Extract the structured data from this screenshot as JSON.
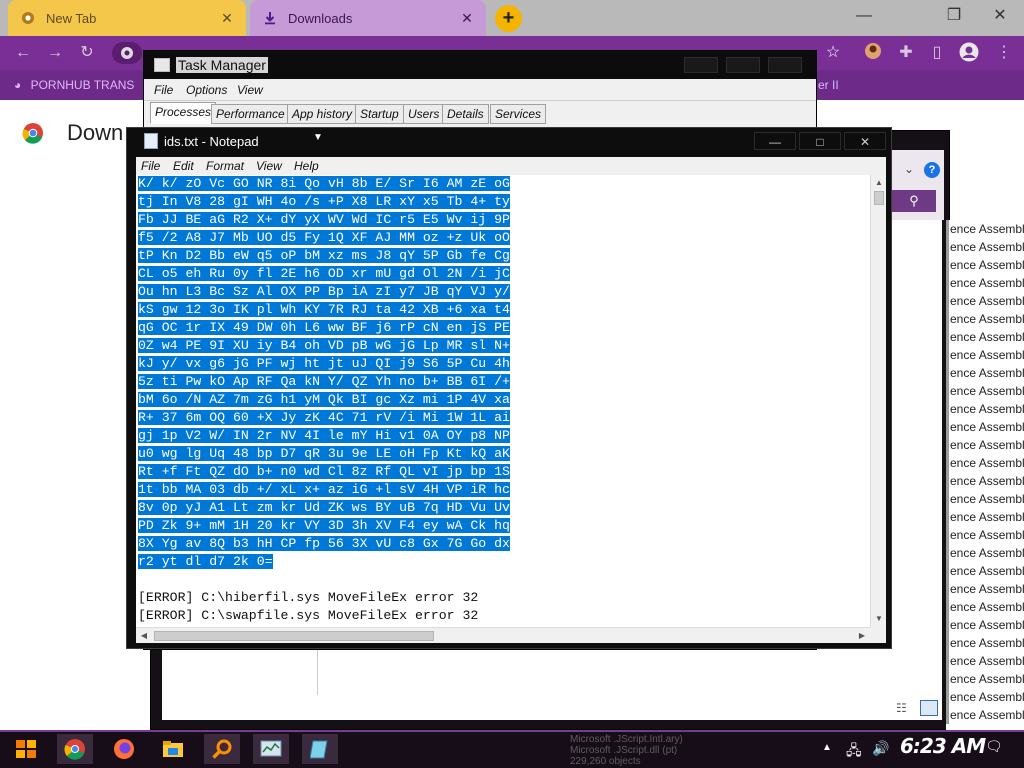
{
  "browser": {
    "tabs": [
      {
        "label": "New Tab",
        "close": "✕"
      },
      {
        "label": "Downloads",
        "close": "✕"
      }
    ],
    "new_tab": "+",
    "window_controls": [
      "—",
      "❐",
      "✕"
    ],
    "bookmark": "PORNHUB TRANS",
    "bookmark_tail": "er II",
    "page_title": "Down",
    "icons": {
      "back": "arrow-left-icon",
      "forward": "arrow-right-icon",
      "reload": "reload-icon",
      "star": "star-icon",
      "extensions": "puzzle-icon",
      "sidepanel": "side-panel-icon",
      "profile": "profile-icon",
      "menu": "kebab-menu-icon"
    }
  },
  "explorer": {
    "rows": [
      "ence Assemblies",
      "ence Assemblies",
      "ence Assemblies",
      "ence Assemblies",
      "ence Assemblies",
      "ence Assemblies",
      "ence Assemblies",
      "ence Assemblies",
      "ence Assemblies",
      "ence Assemblies",
      "ence Assemblies",
      "ence Assemblies",
      "ence Assemblies",
      "ence Assemblies",
      "ence Assemblies",
      "ence Assemblies",
      "ence Assemblies",
      "ence Assemblies",
      "ence Assemblies",
      "ence Assemblies",
      "ence Assemblies",
      "ence Assemblies",
      "ence Assemblies",
      "ence Assemblies",
      "ence Assemblies",
      "ence Assemblies",
      "ence Assemblies",
      "ence Assemblies"
    ],
    "help": "?",
    "search_icon": "⚲"
  },
  "task_manager": {
    "title": "Task Manager",
    "menus": [
      "File",
      "Options",
      "View"
    ],
    "tabs": [
      "Processes",
      "Performance",
      "App history",
      "Startup",
      "Users",
      "Details",
      "Services"
    ],
    "active_tab": "Processes"
  },
  "notepad": {
    "title": "ids.txt - Notepad",
    "menus": [
      "File",
      "Edit",
      "Format",
      "View",
      "Help"
    ],
    "controls": [
      "—",
      "□",
      "✕"
    ],
    "selected_lines": [
      "K/ k/ zO Vc GO NR 8i Qo vH 8b E/ Sr I6 AM zE oG",
      "tj In V8 28 gI WH 4o /s +P X8 LR xY x5 Tb 4+ ty",
      "Fb JJ BE aG R2 X+ dY yX WV Wd IC r5 E5 Wv ij 9P",
      "f5 /2 A8 J7 Mb UO d5 Fy 1Q XF AJ MM oz +z Uk oO",
      "tP Kn D2 Bb eW q5 oP bM xz ms J8 qY 5P Gb fe Cg",
      "CL o5 eh Ru 0y fl 2E h6 OD xr mU gd Ol 2N /i jC",
      "Ou hn L3 Bc Sz Al OX PP Bp iA zI y7 JB qY VJ y/",
      "kS gw 12 3o IK pl Wh KY 7R RJ ta 42 XB +6 xa t4",
      "qG OC 1r IX 49 DW 0h L6 ww BF j6 rP cN en jS PE",
      "0Z w4 PE 9I XU iy B4 oh VD pB wG jG Lp MR sl N+",
      "kJ y/ vx g6 jG PF wj ht jt uJ QI j9 S6 5P Cu 4h",
      "5z ti Pw kO Ap RF Qa kN Y/ QZ Yh no b+ BB 6I /+",
      "bM 6o /N AZ 7m zG h1 yM Qk BI gc Xz mi 1P 4V xa",
      "R+ 37 6m OQ 60 +X Jy zK 4C 71 rV /i Mi 1W 1L ai",
      "gj 1p V2 W/ IN 2r NV 4I le mY Hi v1 0A OY p8 NP",
      "u0 wg lg Uq 48 bp D7 qR 3u 9e LE oH Fp Kt kQ aK",
      "Rt +f Ft QZ dO b+ n0 wd Cl 8z Rf QL vI jp bp 1S",
      "1t bb MA 03 db +/ xL x+ az iG +l sV 4H VP iR hc",
      "8v 0p yJ A1 Lt zm kr Ud ZK ws BY uB 7q HD Vu Uv",
      "PD Zk 9+ mM 1H 20 kr VY 3D 3h XV F4 ey wA Ck hq",
      "8X Yg av 8Q b3 hH CP fp 56 3X vU c8 Gx 7G Go dx",
      "r2 yt dl d7 2k 0="
    ],
    "plain_lines": [
      "",
      "[ERROR] C:\\hiberfil.sys MoveFileEx error 32",
      "[ERROR] C:\\swapfile.sys MoveFileEx error 32"
    ]
  },
  "taskbar": {
    "clock": "6:23 AM",
    "apps": [
      "start-icon",
      "chrome-icon",
      "firefox-icon",
      "file-explorer-icon",
      "search-app-icon",
      "task-manager-icon",
      "notepad-icon"
    ],
    "ghost_lines": [
      "Microsoft .JScript.Intl.ary)",
      "Microsoft .JScript.dll (pt)",
      "229,260 objects"
    ]
  },
  "colors": {
    "accent": "#7a2f96",
    "selection": "#0078d7",
    "tab_yellow": "#f4c64a",
    "tab_purple": "#c69ad6"
  }
}
